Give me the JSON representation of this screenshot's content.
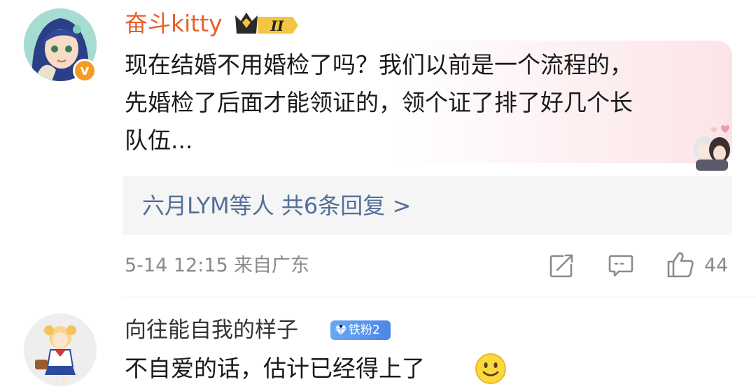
{
  "comments": [
    {
      "username": "奋斗kitty",
      "rank_badge": "II",
      "verified_mark": "v",
      "text_lines": [
        "现在结婚不用婚检了吗？我们以前是一个流程的，",
        "先婚检了后面才能领证的，领个证了排了好几个长",
        "队伍..."
      ],
      "replies_summary": "六月LYM等人  共6条回复 >",
      "date": "5-14 12:15",
      "location": "来自广东",
      "like_count": "44",
      "icons": [
        "share-icon",
        "comment-icon",
        "like-icon"
      ]
    },
    {
      "username": "向往能自我的样子",
      "fan_badge": "铁粉2",
      "text": "不自爱的话，估计已经得上了",
      "emoji": "smile-emoji"
    }
  ],
  "colors": {
    "username_accent": "#e8602c",
    "link": "#52709a",
    "meta_gray": "#8a8a8a",
    "verified_orange": "#f59a23",
    "fan_badge_blue": "#5b97ee"
  }
}
